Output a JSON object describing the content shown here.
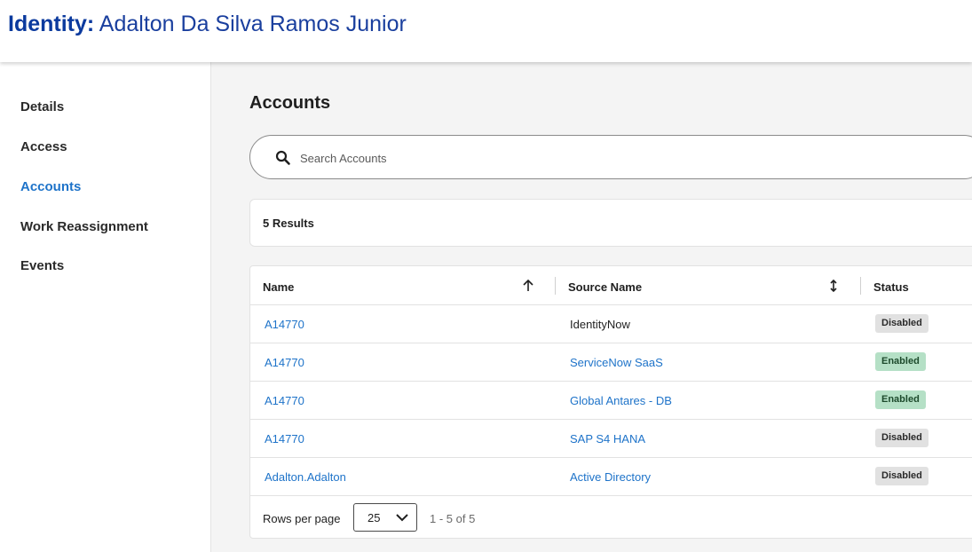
{
  "header": {
    "title_prefix": "Identity:",
    "title_name": "Adalton Da Silva Ramos Junior"
  },
  "sidebar": {
    "items": [
      {
        "label": "Details",
        "active": false
      },
      {
        "label": "Access",
        "active": false
      },
      {
        "label": "Accounts",
        "active": true
      },
      {
        "label": "Work Reassignment",
        "active": false
      },
      {
        "label": "Events",
        "active": false
      }
    ]
  },
  "main": {
    "section_title": "Accounts",
    "search": {
      "placeholder": "Search Accounts",
      "value": "",
      "icon": "search-icon"
    },
    "results_count": "5 Results",
    "table": {
      "columns": [
        {
          "label": "Name",
          "sort": "ascending",
          "sort_icon": "arrow-up-icon"
        },
        {
          "label": "Source Name",
          "sort": "none",
          "sort_icon": "sort-arrows-icon"
        },
        {
          "label": "Status"
        }
      ],
      "rows": [
        {
          "name": "A14770",
          "source": "IdentityNow",
          "source_link": false,
          "status": "Disabled"
        },
        {
          "name": "A14770",
          "source": "ServiceNow SaaS",
          "source_link": true,
          "status": "Enabled"
        },
        {
          "name": "A14770",
          "source": "Global Antares - DB",
          "source_link": true,
          "status": "Enabled"
        },
        {
          "name": "A14770",
          "source": "SAP S4 HANA",
          "source_link": true,
          "status": "Disabled"
        },
        {
          "name": "Adalton.Adalton",
          "source": "Active Directory",
          "source_link": true,
          "status": "Disabled"
        }
      ]
    },
    "pagination": {
      "rows_per_page_label": "Rows per page",
      "rows_per_page_value": "25",
      "range_text": "1 - 5 of 5"
    }
  },
  "colors": {
    "title_blue": "#1a3f9e",
    "link_blue": "#1e73c9",
    "enabled_badge": "#b5e0c6",
    "disabled_badge": "#e1e1e1"
  }
}
